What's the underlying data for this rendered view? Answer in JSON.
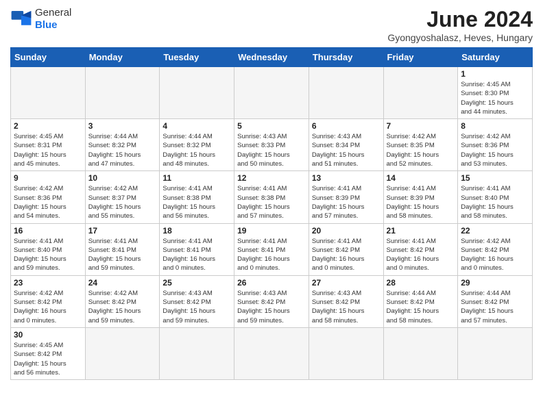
{
  "header": {
    "logo_line1": "General",
    "logo_line2": "Blue",
    "title": "June 2024",
    "subtitle": "Gyongyoshalasz, Heves, Hungary"
  },
  "weekdays": [
    "Sunday",
    "Monday",
    "Tuesday",
    "Wednesday",
    "Thursday",
    "Friday",
    "Saturday"
  ],
  "weeks": [
    [
      {
        "day": "",
        "info": ""
      },
      {
        "day": "",
        "info": ""
      },
      {
        "day": "",
        "info": ""
      },
      {
        "day": "",
        "info": ""
      },
      {
        "day": "",
        "info": ""
      },
      {
        "day": "",
        "info": ""
      },
      {
        "day": "1",
        "info": "Sunrise: 4:45 AM\nSunset: 8:30 PM\nDaylight: 15 hours\nand 44 minutes."
      }
    ],
    [
      {
        "day": "2",
        "info": "Sunrise: 4:45 AM\nSunset: 8:31 PM\nDaylight: 15 hours\nand 45 minutes."
      },
      {
        "day": "3",
        "info": "Sunrise: 4:44 AM\nSunset: 8:32 PM\nDaylight: 15 hours\nand 47 minutes."
      },
      {
        "day": "4",
        "info": "Sunrise: 4:44 AM\nSunset: 8:32 PM\nDaylight: 15 hours\nand 48 minutes."
      },
      {
        "day": "5",
        "info": "Sunrise: 4:43 AM\nSunset: 8:33 PM\nDaylight: 15 hours\nand 50 minutes."
      },
      {
        "day": "6",
        "info": "Sunrise: 4:43 AM\nSunset: 8:34 PM\nDaylight: 15 hours\nand 51 minutes."
      },
      {
        "day": "7",
        "info": "Sunrise: 4:42 AM\nSunset: 8:35 PM\nDaylight: 15 hours\nand 52 minutes."
      },
      {
        "day": "8",
        "info": "Sunrise: 4:42 AM\nSunset: 8:36 PM\nDaylight: 15 hours\nand 53 minutes."
      }
    ],
    [
      {
        "day": "9",
        "info": "Sunrise: 4:42 AM\nSunset: 8:36 PM\nDaylight: 15 hours\nand 54 minutes."
      },
      {
        "day": "10",
        "info": "Sunrise: 4:42 AM\nSunset: 8:37 PM\nDaylight: 15 hours\nand 55 minutes."
      },
      {
        "day": "11",
        "info": "Sunrise: 4:41 AM\nSunset: 8:38 PM\nDaylight: 15 hours\nand 56 minutes."
      },
      {
        "day": "12",
        "info": "Sunrise: 4:41 AM\nSunset: 8:38 PM\nDaylight: 15 hours\nand 57 minutes."
      },
      {
        "day": "13",
        "info": "Sunrise: 4:41 AM\nSunset: 8:39 PM\nDaylight: 15 hours\nand 57 minutes."
      },
      {
        "day": "14",
        "info": "Sunrise: 4:41 AM\nSunset: 8:39 PM\nDaylight: 15 hours\nand 58 minutes."
      },
      {
        "day": "15",
        "info": "Sunrise: 4:41 AM\nSunset: 8:40 PM\nDaylight: 15 hours\nand 58 minutes."
      }
    ],
    [
      {
        "day": "16",
        "info": "Sunrise: 4:41 AM\nSunset: 8:40 PM\nDaylight: 15 hours\nand 59 minutes."
      },
      {
        "day": "17",
        "info": "Sunrise: 4:41 AM\nSunset: 8:41 PM\nDaylight: 15 hours\nand 59 minutes."
      },
      {
        "day": "18",
        "info": "Sunrise: 4:41 AM\nSunset: 8:41 PM\nDaylight: 16 hours\nand 0 minutes."
      },
      {
        "day": "19",
        "info": "Sunrise: 4:41 AM\nSunset: 8:41 PM\nDaylight: 16 hours\nand 0 minutes."
      },
      {
        "day": "20",
        "info": "Sunrise: 4:41 AM\nSunset: 8:42 PM\nDaylight: 16 hours\nand 0 minutes."
      },
      {
        "day": "21",
        "info": "Sunrise: 4:41 AM\nSunset: 8:42 PM\nDaylight: 16 hours\nand 0 minutes."
      },
      {
        "day": "22",
        "info": "Sunrise: 4:42 AM\nSunset: 8:42 PM\nDaylight: 16 hours\nand 0 minutes."
      }
    ],
    [
      {
        "day": "23",
        "info": "Sunrise: 4:42 AM\nSunset: 8:42 PM\nDaylight: 16 hours\nand 0 minutes."
      },
      {
        "day": "24",
        "info": "Sunrise: 4:42 AM\nSunset: 8:42 PM\nDaylight: 15 hours\nand 59 minutes."
      },
      {
        "day": "25",
        "info": "Sunrise: 4:43 AM\nSunset: 8:42 PM\nDaylight: 15 hours\nand 59 minutes."
      },
      {
        "day": "26",
        "info": "Sunrise: 4:43 AM\nSunset: 8:42 PM\nDaylight: 15 hours\nand 59 minutes."
      },
      {
        "day": "27",
        "info": "Sunrise: 4:43 AM\nSunset: 8:42 PM\nDaylight: 15 hours\nand 58 minutes."
      },
      {
        "day": "28",
        "info": "Sunrise: 4:44 AM\nSunset: 8:42 PM\nDaylight: 15 hours\nand 58 minutes."
      },
      {
        "day": "29",
        "info": "Sunrise: 4:44 AM\nSunset: 8:42 PM\nDaylight: 15 hours\nand 57 minutes."
      }
    ],
    [
      {
        "day": "30",
        "info": "Sunrise: 4:45 AM\nSunset: 8:42 PM\nDaylight: 15 hours\nand 56 minutes."
      },
      {
        "day": "",
        "info": ""
      },
      {
        "day": "",
        "info": ""
      },
      {
        "day": "",
        "info": ""
      },
      {
        "day": "",
        "info": ""
      },
      {
        "day": "",
        "info": ""
      },
      {
        "day": "",
        "info": ""
      }
    ]
  ]
}
